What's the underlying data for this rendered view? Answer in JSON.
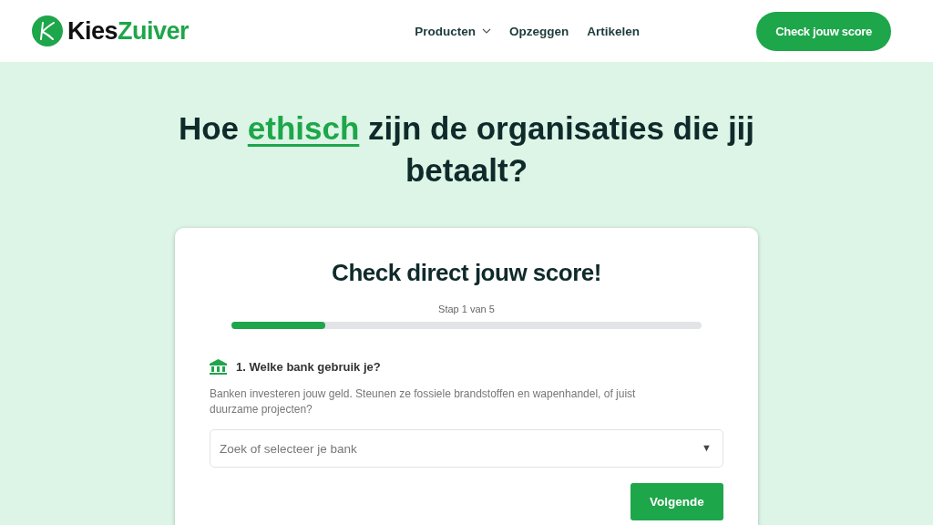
{
  "header": {
    "logo": {
      "dark_part": "Kies",
      "green_part": "Zuiver"
    },
    "nav": [
      {
        "label": "Producten",
        "has_dropdown": true
      },
      {
        "label": "Opzeggen",
        "has_dropdown": false
      },
      {
        "label": "Artikelen",
        "has_dropdown": false
      }
    ],
    "cta": "Check jouw score"
  },
  "hero": {
    "title_before": "Hoe ",
    "title_highlight": "ethisch",
    "title_after": " zijn de organisaties die jij betaalt?"
  },
  "quiz": {
    "title": "Check direct jouw score!",
    "step": "Stap 1 van 5",
    "progress": {
      "level": 0.2
    },
    "question": "1. Welke bank gebruik je?",
    "description": "Banken investeren jouw geld. Steunen ze fossiele brandstoffen en wapenhandel, of juist duurzame projecten?",
    "select": {
      "placeholder": "Zoek of selecteer je bank",
      "arrow": "▼"
    },
    "next_button": "Volgende"
  }
}
